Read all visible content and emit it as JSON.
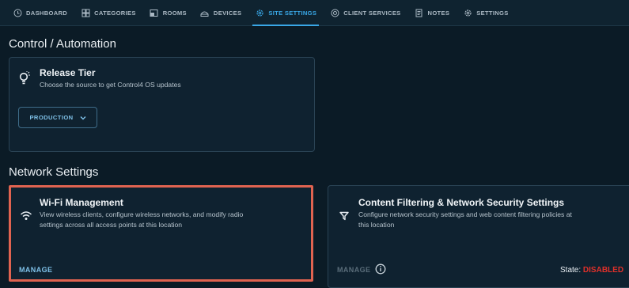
{
  "nav": {
    "items": [
      {
        "label": "DASHBOARD",
        "icon": "clock-icon"
      },
      {
        "label": "CATEGORIES",
        "icon": "categories-icon"
      },
      {
        "label": "ROOMS",
        "icon": "rooms-icon"
      },
      {
        "label": "DEVICES",
        "icon": "devices-icon"
      },
      {
        "label": "SITE SETTINGS",
        "icon": "gear-icon",
        "active": true
      },
      {
        "label": "CLIENT SERVICES",
        "icon": "support-icon"
      },
      {
        "label": "NOTES",
        "icon": "notes-icon"
      },
      {
        "label": "SETTINGS",
        "icon": "gear-icon"
      }
    ]
  },
  "control": {
    "section_title": "Control / Automation",
    "release_tier": {
      "title": "Release Tier",
      "description": "Choose the source to get Control4 OS updates",
      "dropdown_value": "PRODUCTION",
      "icon": "lightbulb-icon"
    }
  },
  "network": {
    "section_title": "Network Settings",
    "wifi": {
      "title": "Wi-Fi Management",
      "description_line1": "View wireless clients, configure wireless networks, and modify radio",
      "description_line2": "settings across all access points at this location",
      "action": "MANAGE",
      "icon": "wifi-icon"
    },
    "content_filtering": {
      "title": "Content Filtering & Network Security Settings",
      "description_line1": "Configure network security settings and web content filtering policies at",
      "description_line2": "this location",
      "action": "MANAGE",
      "state_label": "State:",
      "state_value": "DISABLED",
      "icon": "filter-icon"
    }
  },
  "colors": {
    "accent": "#39a7e6",
    "highlight": "#e06350",
    "disabled": "#e0302a"
  }
}
